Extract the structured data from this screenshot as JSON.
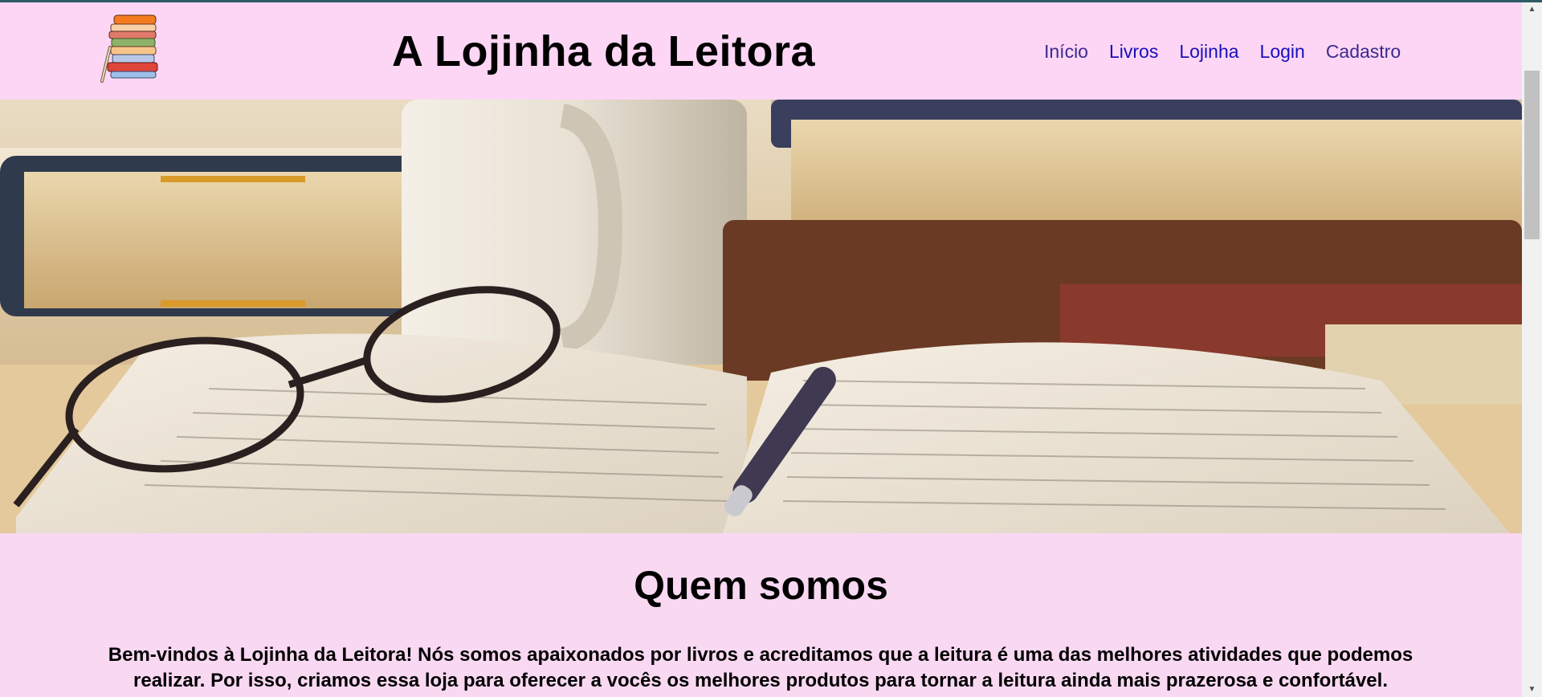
{
  "header": {
    "site_title": "A Lojinha da Leitora",
    "logo_icon": "book-stack-icon",
    "nav": [
      {
        "label": "Início"
      },
      {
        "label": "Livros"
      },
      {
        "label": "Lojinha"
      },
      {
        "label": "Login"
      },
      {
        "label": "Cadastro"
      }
    ]
  },
  "hero": {
    "image": "books-glasses-mug-photo"
  },
  "about": {
    "title": "Quem somos",
    "paragraph_line1": "Bem-vindos à Lojinha da Leitora! Nós somos apaixonados por livros e acreditamos que a leitura é uma das melhores atividades que podemos",
    "paragraph_line2": "realizar. Por isso, criamos essa loja para oferecer a vocês os melhores produtos para tornar a leitura ainda mais prazerosa e confortável."
  },
  "colors": {
    "header_bg": "#fcd6f4",
    "page_bg": "#f9d8f2",
    "nav_link": "#1a0dbd",
    "nav_visited": "#3c2a8f"
  }
}
